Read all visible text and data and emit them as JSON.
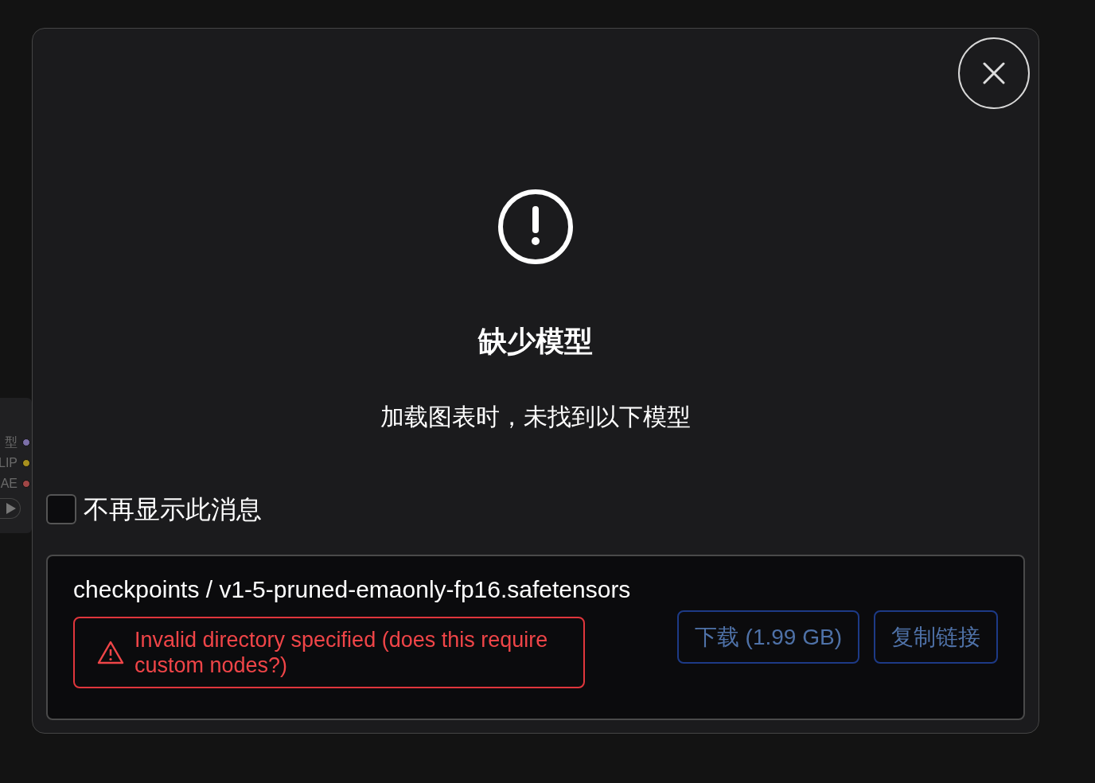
{
  "background_node": {
    "outputs": [
      {
        "label": "型",
        "color": "#7b6fa8"
      },
      {
        "label": "LIP",
        "color": "#a8901e"
      },
      {
        "label": "AE",
        "color": "#a04646"
      }
    ]
  },
  "dialog": {
    "title": "缺少模型",
    "message": "加载图表时，未找到以下模型",
    "dont_show_again": {
      "label": "不再显示此消息",
      "checked": false
    },
    "models": [
      {
        "path": "checkpoints / v1-5-pruned-emaonly-fp16.safetensors",
        "error": "Invalid directory specified (does this require custom nodes?)",
        "download_label": "下载 (1.99 GB)",
        "copy_label": "复制链接"
      }
    ]
  }
}
